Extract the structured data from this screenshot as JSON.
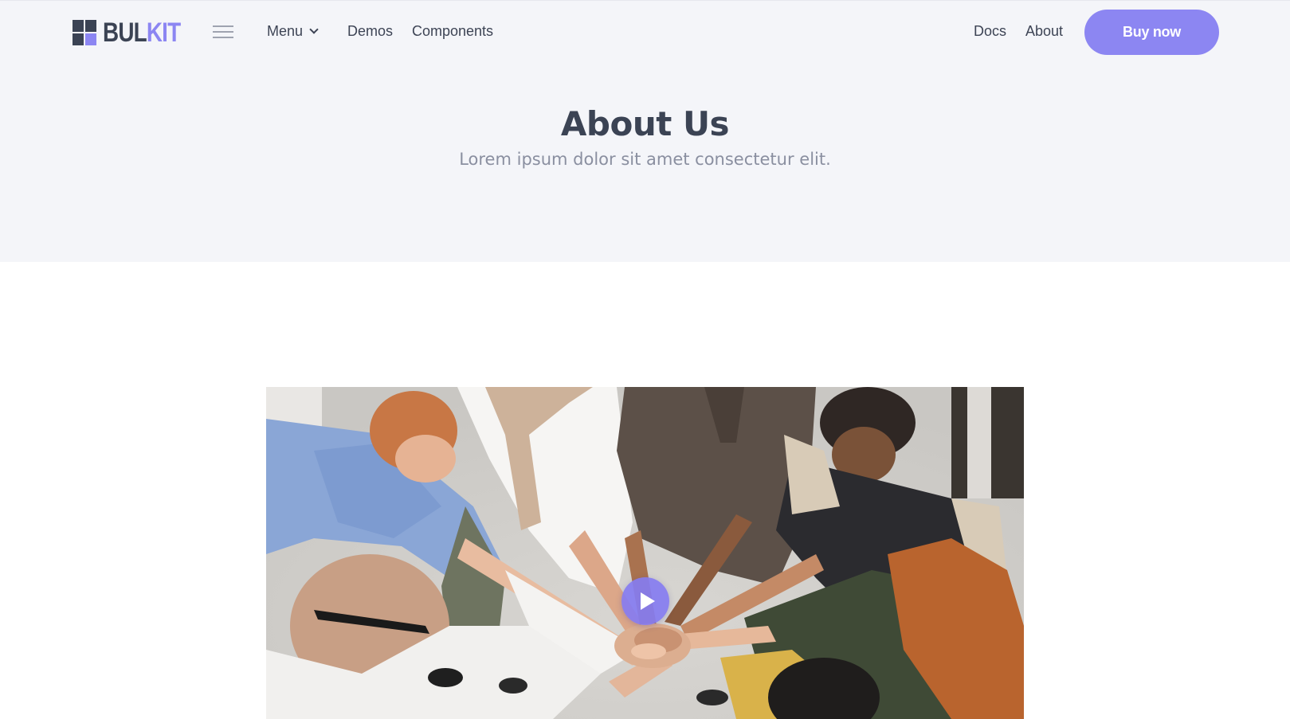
{
  "brand": {
    "part1": "BUL",
    "part2": "KIT"
  },
  "nav": {
    "menu_label": "Menu",
    "demos_label": "Demos",
    "components_label": "Components",
    "docs_label": "Docs",
    "about_label": "About",
    "buy_label": "Buy now"
  },
  "hero": {
    "title": "About Us",
    "subtitle": "Lorem ipsum dolor sit amet consectetur elit."
  },
  "media": {
    "image_description": "team-hands-together-photo",
    "play_icon": "play-icon"
  },
  "colors": {
    "accent": "#8c86f2",
    "dark": "#3b4354",
    "hero_bg": "#f4f5f9",
    "muted": "#8a8fa0"
  }
}
